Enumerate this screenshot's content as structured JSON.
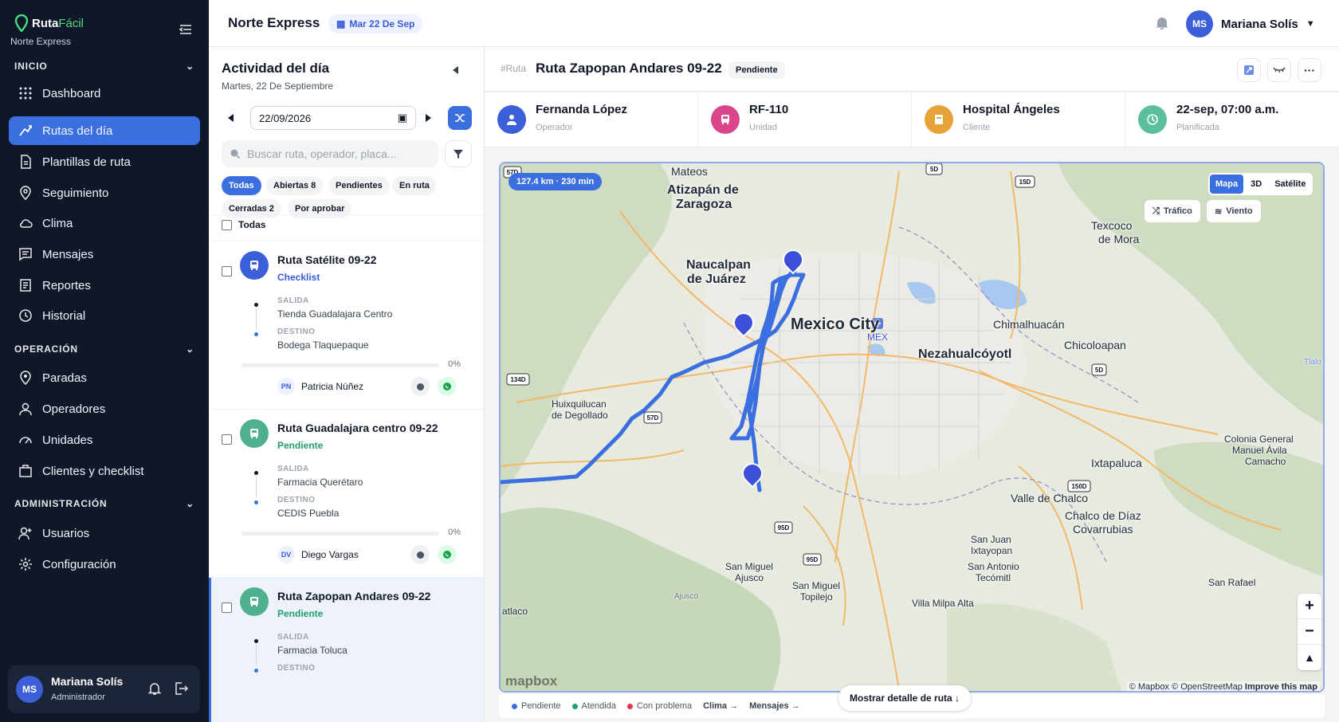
{
  "app": {
    "brand_a": "Ruta",
    "brand_b": "Fácil",
    "company": "Norte Express"
  },
  "sidebar": {
    "sections": [
      {
        "title": "INICIO"
      },
      {
        "title": "OPERACIÓN"
      },
      {
        "title": "ADMINISTRACIÓN"
      }
    ],
    "items": [
      {
        "label": "Dashboard"
      },
      {
        "label": "Rutas del día"
      },
      {
        "label": "Plantillas de ruta"
      },
      {
        "label": "Seguimiento"
      },
      {
        "label": "Clima"
      },
      {
        "label": "Mensajes"
      },
      {
        "label": "Reportes"
      },
      {
        "label": "Historial"
      },
      {
        "label": "Paradas"
      },
      {
        "label": "Operadores"
      },
      {
        "label": "Unidades"
      },
      {
        "label": "Clientes y checklist"
      },
      {
        "label": "Usuarios"
      },
      {
        "label": "Configuración"
      }
    ],
    "user": {
      "initials": "MS",
      "name": "Mariana Solís",
      "role": "Administrador"
    }
  },
  "topbar": {
    "company": "Norte Express",
    "date_chip": "Mar 22 De Sep",
    "user_initials": "MS",
    "user_name": "Mariana Solís"
  },
  "activity": {
    "title": "Actividad del día",
    "subtitle": "Martes, 22 De Septiembre",
    "date_value": "22/09/2026",
    "search_placeholder": "Buscar ruta, operador, placa...",
    "filters": [
      {
        "label": "Todas"
      },
      {
        "label": "Abiertas 8"
      },
      {
        "label": "Pendientes"
      },
      {
        "label": "En ruta"
      },
      {
        "label": "Cerradas 2"
      },
      {
        "label": "Por aprobar"
      }
    ],
    "select_all": "Todas",
    "salida_label": "SALIDA",
    "destino_label": "DESTINO",
    "routes": [
      {
        "name": "Ruta Satélite 09-22",
        "status": "Checklist",
        "status_color": "#3b5bdb",
        "icon_color": "#3b5ed9",
        "salida": "Tienda Guadalajara Centro",
        "destino": "Bodega Tlaquepaque",
        "progress": "0%",
        "operator_initials": "PN",
        "operator": "Patricia Núñez"
      },
      {
        "name": "Ruta Guadalajara centro 09-22",
        "status": "Pendiente",
        "status_color": "#22a06b",
        "icon_color": "#4fb08f",
        "salida": "Farmacia Querétaro",
        "destino": "CEDIS Puebla",
        "progress": "0%",
        "operator_initials": "DV",
        "operator": "Diego Vargas"
      },
      {
        "name": "Ruta Zapopan Andares 09-22",
        "status": "Pendiente",
        "status_color": "#22a06b",
        "icon_color": "#4fb08f",
        "salida": "Farmacia Toluca",
        "destino": ""
      }
    ]
  },
  "route_detail": {
    "tag": "#Ruta",
    "title": "Ruta Zapopan Andares 09-22",
    "badge": "Pendiente",
    "info": [
      {
        "value": "Fernanda López",
        "label": "Operador",
        "color": "#3b5ed9"
      },
      {
        "value": "RF-110",
        "label": "Unidad",
        "color": "#d9468a"
      },
      {
        "value": "Hospital Ángeles",
        "label": "Cliente",
        "color": "#e8a23a"
      },
      {
        "value": "22-sep, 07:00 a.m.",
        "label": "Planificada",
        "color": "#5bbf9d"
      }
    ]
  },
  "map": {
    "distance": "127.4 km · 230 min",
    "types": [
      {
        "label": "Mapa"
      },
      {
        "label": "3D"
      },
      {
        "label": "Satélite"
      }
    ],
    "traffic": "Tráfico",
    "wind": "Viento",
    "labels": [
      "Mateos",
      "Atizapán de",
      "Zaragoza",
      "Texcoco",
      "de Mora",
      "Naucalpan",
      "de Juárez",
      "Mexico City",
      "MEX",
      "Chimalhuacán",
      "Chicoloapan",
      "Nezahualcóyotl",
      "Huixquilucan",
      "de Degollado",
      "Colonia General",
      "Manuel Ávila",
      "Camacho",
      "Ixtapaluca",
      "Valle de Chalco",
      "Chalco de Díaz",
      "Covarrubias",
      "San Juan",
      "Ixtayopan",
      "San Antonio",
      "Tecómitl",
      "San Miguel",
      "Ajusco",
      "San Miguel",
      "Topilejo",
      "Ajusco",
      "Villa Milpa Alta",
      "San Rafael",
      "atlaco",
      "Tlalo"
    ],
    "shields": [
      "5D",
      "15D",
      "134D",
      "57D",
      "95D",
      "150D",
      "95D",
      "5D",
      "57D"
    ],
    "logo": "mapbox",
    "attribution_a": "© Mapbox © OpenStreetMap",
    "attribution_b": "Improve this map"
  },
  "legend": {
    "items": [
      {
        "label": "Pendiente",
        "color": "#3b6fe0"
      },
      {
        "label": "Atendida",
        "color": "#22a06b"
      },
      {
        "label": "Con problema",
        "color": "#e0394a"
      }
    ],
    "links": [
      "Clima →",
      "Mensajes →"
    ],
    "detail_button": "Mostrar detalle de ruta ↓"
  }
}
